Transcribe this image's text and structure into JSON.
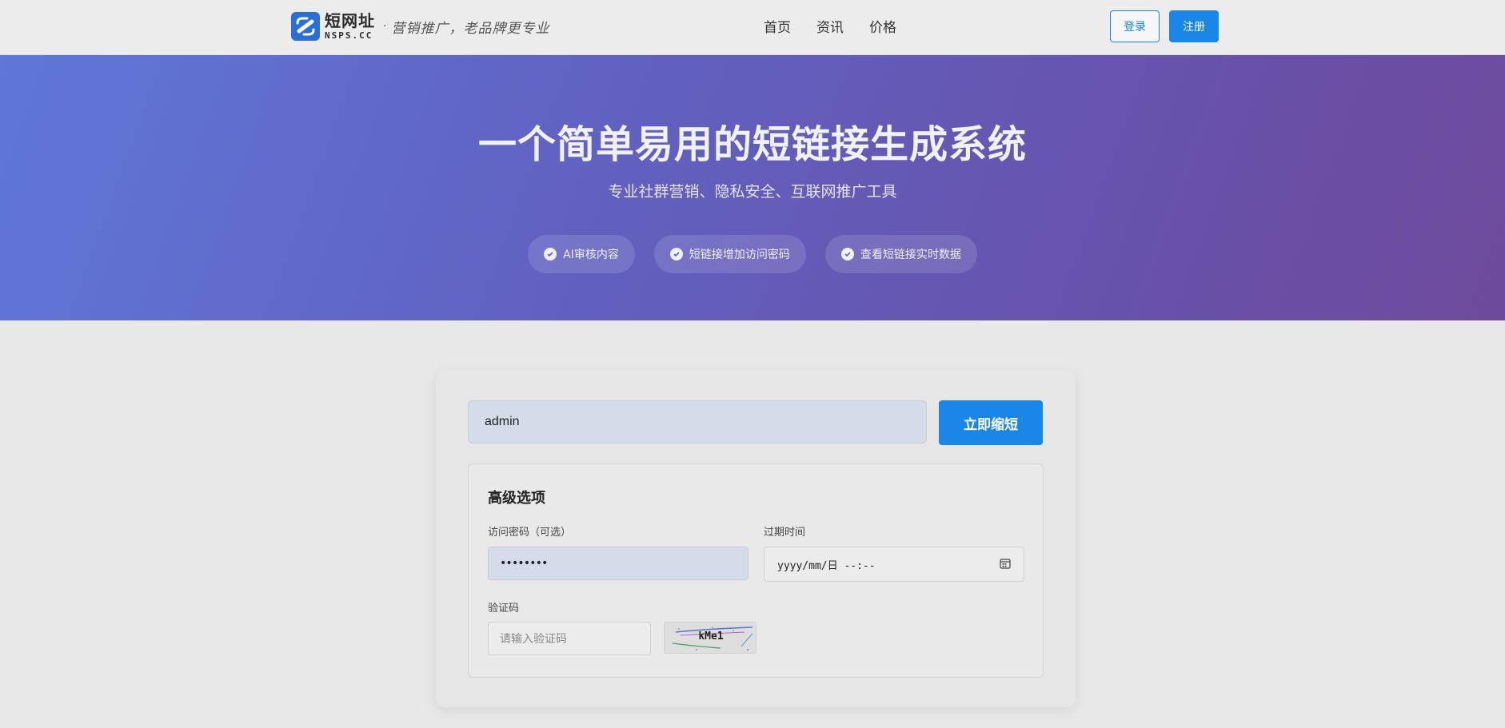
{
  "header": {
    "logo_cn": "短网址",
    "logo_en": "NSPS.CC",
    "logo_separator": "·",
    "slogan": "营销推广，老品牌更专业",
    "nav": [
      "首页",
      "资讯",
      "价格"
    ],
    "login_label": "登录",
    "register_label": "注册"
  },
  "hero": {
    "title": "一个简单易用的短链接生成系统",
    "subtitle": "专业社群营销、隐私安全、互联网推广工具",
    "features": [
      "AI审核内容",
      "短链接增加访问密码",
      "查看短链接实时数据"
    ]
  },
  "shortener": {
    "url_value": "admin",
    "submit_label": "立即缩短",
    "advanced_title": "高级选项",
    "password_label": "访问密码（可选）",
    "password_value": "••••••••",
    "expire_label": "过期时间",
    "expire_value": "yyyy/mm/日 --:--",
    "captcha_label": "验证码",
    "captcha_placeholder": "请输入验证码",
    "captcha_code": "kMe1"
  },
  "colors": {
    "primary": "#1a86e8",
    "hero_start": "#5f77d8",
    "hero_end": "#6e4a9b"
  }
}
